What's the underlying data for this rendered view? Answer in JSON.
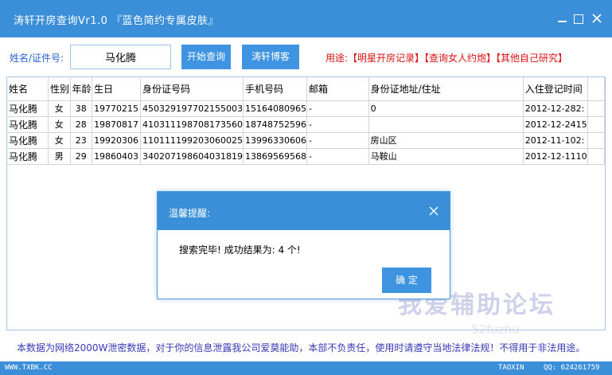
{
  "window": {
    "title": "涛轩开房查询Vr1.0  『蓝色简约专属皮肤』"
  },
  "toolbar": {
    "name_label": "姓名/证件号:",
    "name_value": "马化腾",
    "search_button": "开始查询",
    "blog_button": "涛轩博客",
    "usage_text": "用途:【明星开房记录】【查询女人约炮】【其他自己研究】"
  },
  "table": {
    "columns": [
      "姓名",
      "性别",
      "年龄",
      "生日",
      "身份证号码",
      "手机号码",
      "邮箱",
      "身份证地址/住址",
      "入住登记时间"
    ],
    "rows": [
      [
        "马化腾",
        "女",
        "38",
        "19770215",
        "450329197702155003",
        "15164080965",
        "-",
        "0",
        "2012-12-282:"
      ],
      [
        "马化腾",
        "女",
        "28",
        "19870817",
        "410311198708173560",
        "18748752596",
        "-",
        "",
        "2012-12-2415"
      ],
      [
        "马化腾",
        "女",
        "23",
        "19920306",
        "110111199203060025",
        "13996330606",
        "-",
        "房山区",
        "2012-11-102:"
      ],
      [
        "马化腾",
        "男",
        "29",
        "19860403",
        "340207198604031819",
        "13869569568",
        "-",
        "马鞍山",
        "2012-12-1110"
      ]
    ]
  },
  "footer": {
    "note": "本数据为网络2000W泄密数据，对于你的信息泄露我公司爱莫能助，本部不负责任，使用时请遵守当地法律法规！不得用于非法用途。"
  },
  "statusbar": {
    "left": "WWW.TXBK.CC",
    "middle": "TAOXIN",
    "right": "QQ: 624261759"
  },
  "dialog": {
    "title": "温馨提醒:",
    "message": "搜索完毕! 成功结果为: 4 个!",
    "ok_button": "确 定"
  },
  "watermark": {
    "text": "我爱辅助论坛",
    "sub": "52fuzhu"
  },
  "colors": {
    "accent": "#3a8fd8",
    "usage_red": "#dd1111",
    "label_blue": "#2a64d8",
    "footer_purple": "#3838b8"
  }
}
